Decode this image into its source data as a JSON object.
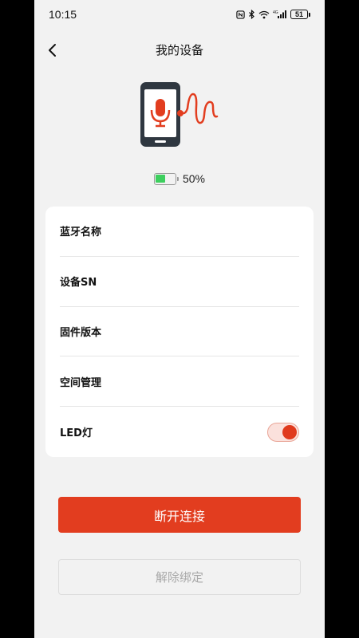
{
  "status_bar": {
    "time": "10:15",
    "battery": "51",
    "icons": [
      "nfc-icon",
      "bluetooth-icon",
      "wifi-icon",
      "signal-icon"
    ]
  },
  "header": {
    "title": "我的设备"
  },
  "device": {
    "battery_percent": "50%",
    "battery_level": 0.5
  },
  "settings": [
    {
      "label": "蓝牙名称"
    },
    {
      "label": "设备SN"
    },
    {
      "label": "固件版本"
    },
    {
      "label": "空间管理"
    },
    {
      "label": "LED灯",
      "toggle_on": true
    }
  ],
  "actions": {
    "disconnect_label": "断开连接",
    "unbind_label": "解除绑定"
  },
  "colors": {
    "accent": "#e23d1f",
    "background": "#f2f2f2",
    "card": "#ffffff",
    "battery_green": "#3dcf5e"
  }
}
